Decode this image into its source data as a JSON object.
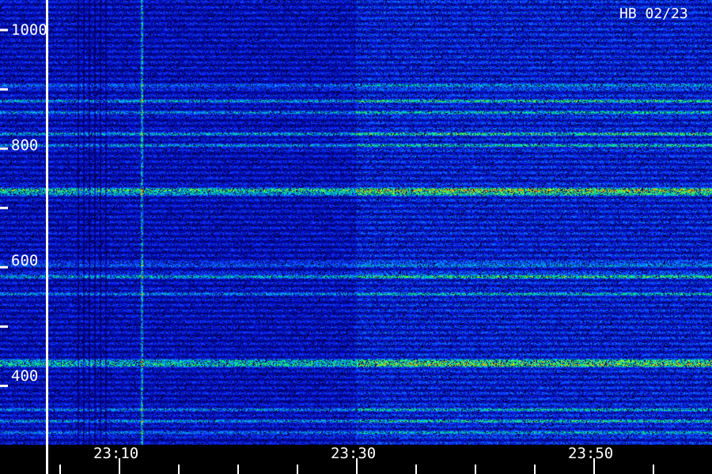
{
  "chart_data": {
    "type": "heatmap",
    "title": "HB 02/23",
    "xlabel": "",
    "ylabel": "",
    "x_tick_labels": [
      "23:10",
      "23:30",
      "23:50"
    ],
    "y_tick_labels": [
      "400",
      "600",
      "800",
      "1000"
    ],
    "y_range": [
      300,
      1050
    ],
    "colormap": [
      "#000022",
      "#0000a0",
      "#1030ff",
      "#00a0ff",
      "#00ff60",
      "#ffe000",
      "#ff0000"
    ],
    "background_color": "#000000",
    "text_color": "#ffffff",
    "persistent_bands": [
      {
        "y": 905,
        "strength": 0.45
      },
      {
        "y": 880,
        "strength": 0.55
      },
      {
        "y": 860,
        "strength": 0.5
      },
      {
        "y": 825,
        "strength": 0.6
      },
      {
        "y": 805,
        "strength": 0.5
      },
      {
        "y": 728,
        "strength": 1.0
      },
      {
        "y": 605,
        "strength": 0.45
      },
      {
        "y": 585,
        "strength": 0.7
      },
      {
        "y": 555,
        "strength": 0.45
      },
      {
        "y": 438,
        "strength": 0.95
      },
      {
        "y": 360,
        "strength": 0.45
      },
      {
        "y": 340,
        "strength": 0.5
      },
      {
        "y": 320,
        "strength": 0.45
      }
    ],
    "transient_burst_time": "23:10"
  }
}
